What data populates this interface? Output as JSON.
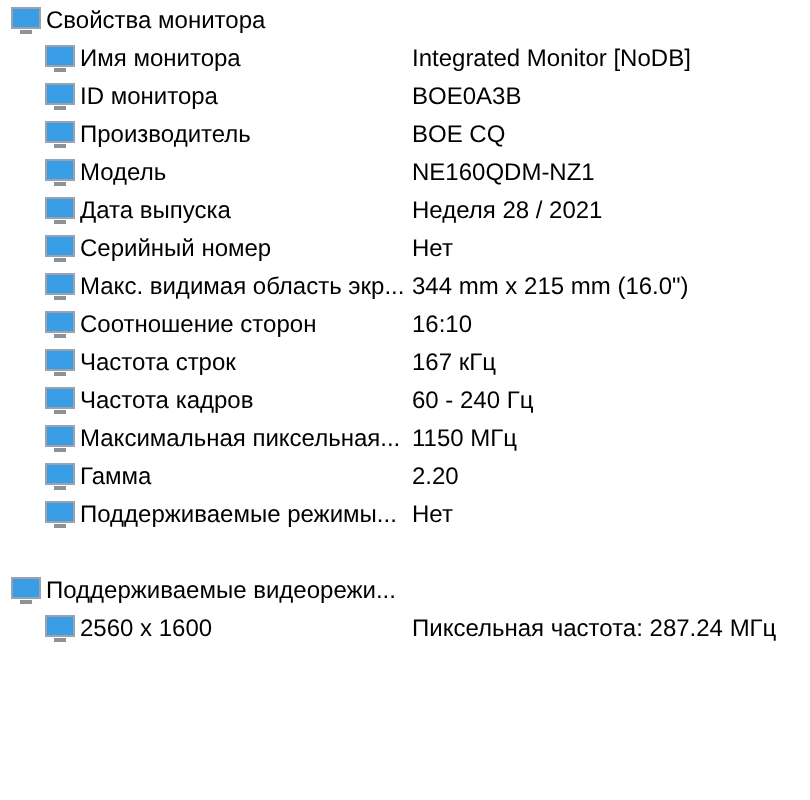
{
  "sections": [
    {
      "title": "Свойства монитора",
      "items": [
        {
          "label": "Имя монитора",
          "value": "Integrated Monitor [NoDB]"
        },
        {
          "label": "ID монитора",
          "value": "BOE0A3B"
        },
        {
          "label": "Производитель",
          "value": "BOE CQ"
        },
        {
          "label": "Модель",
          "value": "NE160QDM-NZ1"
        },
        {
          "label": "Дата выпуска",
          "value": "Неделя 28 / 2021"
        },
        {
          "label": "Серийный номер",
          "value": "Нет"
        },
        {
          "label": "Макс. видимая область экр...",
          "value": "344 mm x 215 mm (16.0\")"
        },
        {
          "label": "Соотношение сторон",
          "value": "16:10"
        },
        {
          "label": "Частота строк",
          "value": "167 кГц"
        },
        {
          "label": "Частота кадров",
          "value": "60 - 240 Гц"
        },
        {
          "label": "Максимальная пиксельная...",
          "value": "1150 МГц"
        },
        {
          "label": "Гамма",
          "value": "2.20"
        },
        {
          "label": "Поддерживаемые режимы...",
          "value": "Нет"
        }
      ]
    },
    {
      "title": "Поддерживаемые видеорежи...",
      "items": [
        {
          "label": "2560 x 1600",
          "value": "Пиксельная частота: 287.24 МГц"
        }
      ]
    }
  ]
}
